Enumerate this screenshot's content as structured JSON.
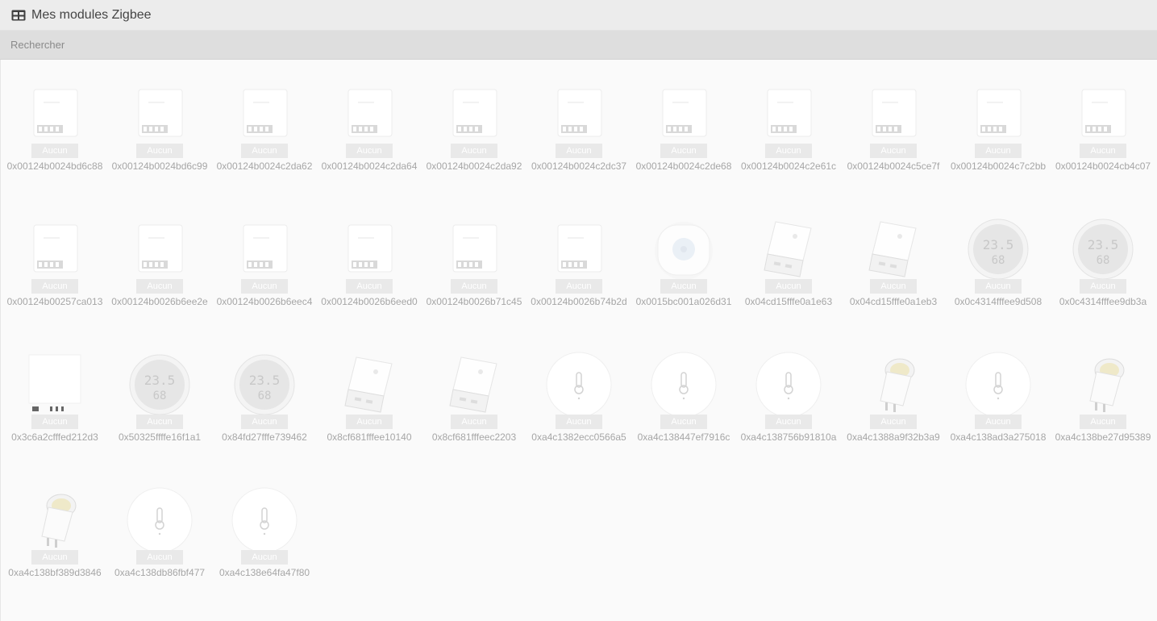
{
  "header": {
    "title": "Mes modules Zigbee",
    "icon": "table-icon"
  },
  "search": {
    "placeholder": "Rechercher"
  },
  "devices": [
    {
      "name": "0x00124b0024bd6c88",
      "type": "relay",
      "status": "Aucun"
    },
    {
      "name": "0x00124b0024bd6c99",
      "type": "relay",
      "status": "Aucun"
    },
    {
      "name": "0x00124b0024c2da62",
      "type": "relay",
      "status": "Aucun"
    },
    {
      "name": "0x00124b0024c2da64",
      "type": "relay",
      "status": "Aucun"
    },
    {
      "name": "0x00124b0024c2da92",
      "type": "relay",
      "status": "Aucun"
    },
    {
      "name": "0x00124b0024c2dc37",
      "type": "relay",
      "status": "Aucun"
    },
    {
      "name": "0x00124b0024c2de68",
      "type": "relay",
      "status": "Aucun"
    },
    {
      "name": "0x00124b0024c2e61c",
      "type": "relay",
      "status": "Aucun"
    },
    {
      "name": "0x00124b0024c5ce7f",
      "type": "relay",
      "status": "Aucun"
    },
    {
      "name": "0x00124b0024c7c2bb",
      "type": "relay",
      "status": "Aucun"
    },
    {
      "name": "0x00124b0024cb4c07",
      "type": "relay",
      "status": "Aucun"
    },
    {
      "name": "0x00124b00257ca013",
      "type": "relay",
      "status": "Aucun"
    },
    {
      "name": "0x00124b0026b6ee2e",
      "type": "relay",
      "status": "Aucun"
    },
    {
      "name": "0x00124b0026b6eec4",
      "type": "relay",
      "status": "Aucun"
    },
    {
      "name": "0x00124b0026b6eed0",
      "type": "relay",
      "status": "Aucun"
    },
    {
      "name": "0x00124b0026b71c45",
      "type": "relay",
      "status": "Aucun"
    },
    {
      "name": "0x00124b0026b74b2d",
      "type": "relay",
      "status": "Aucun"
    },
    {
      "name": "0x0015bc001a026d31",
      "type": "motion",
      "status": "Aucun"
    },
    {
      "name": "0x04cd15fffe0a1e63",
      "type": "usb",
      "status": "Aucun"
    },
    {
      "name": "0x04cd15fffe0a1eb3",
      "type": "usb",
      "status": "Aucun"
    },
    {
      "name": "0x0c4314fffee9d508",
      "type": "lcd",
      "status": "Aucun"
    },
    {
      "name": "0x0c4314fffee9db3a",
      "type": "lcd",
      "status": "Aucun"
    },
    {
      "name": "0x3c6a2cfffed212d3",
      "type": "board",
      "status": "Aucun"
    },
    {
      "name": "0x50325ffffe16f1a1",
      "type": "lcd",
      "status": "Aucun"
    },
    {
      "name": "0x84fd27fffe739462",
      "type": "lcd",
      "status": "Aucun"
    },
    {
      "name": "0x8cf681fffee10140",
      "type": "usb",
      "status": "Aucun"
    },
    {
      "name": "0x8cf681fffeec2203",
      "type": "usb",
      "status": "Aucun"
    },
    {
      "name": "0xa4c1382ecc0566a5",
      "type": "temp",
      "status": "Aucun"
    },
    {
      "name": "0xa4c138447ef7916c",
      "type": "temp",
      "status": "Aucun"
    },
    {
      "name": "0xa4c138756b91810a",
      "type": "temp",
      "status": "Aucun"
    },
    {
      "name": "0xa4c1388a9f32b3a9",
      "type": "plug",
      "status": "Aucun"
    },
    {
      "name": "0xa4c138ad3a275018",
      "type": "temp",
      "status": "Aucun"
    },
    {
      "name": "0xa4c138be27d95389",
      "type": "plug",
      "status": "Aucun"
    },
    {
      "name": "0xa4c138bf389d3846",
      "type": "plug",
      "status": "Aucun"
    },
    {
      "name": "0xa4c138db86fbf477",
      "type": "temp",
      "status": "Aucun"
    },
    {
      "name": "0xa4c138e64fa47f80",
      "type": "temp",
      "status": "Aucun"
    }
  ]
}
